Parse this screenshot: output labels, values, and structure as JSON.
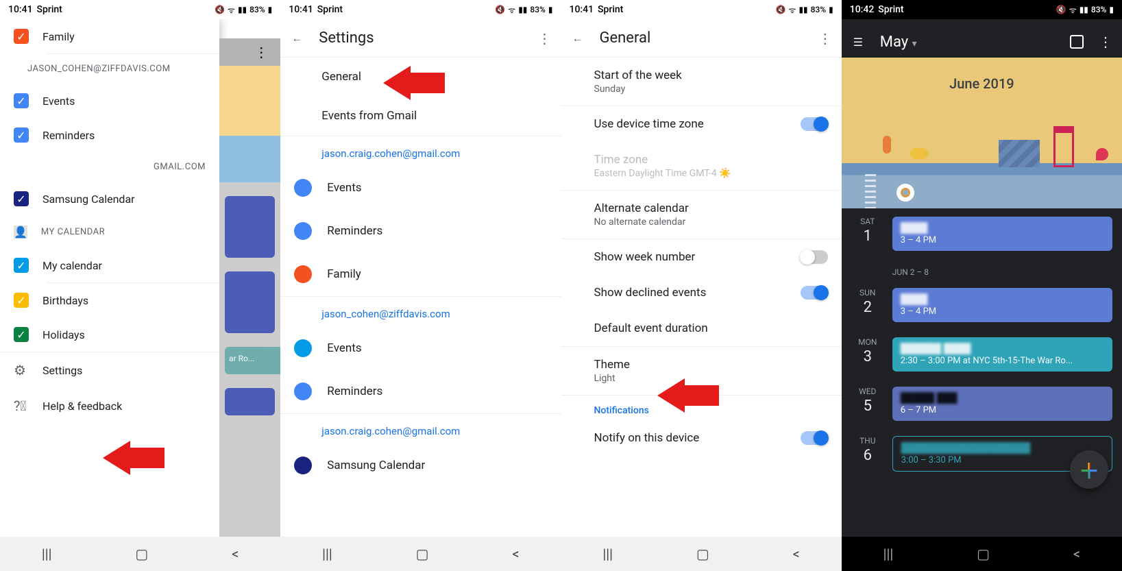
{
  "statusbar": {
    "time1": "10:41",
    "time4": "10:42",
    "carrier": "Sprint",
    "battery": "83%"
  },
  "screen1": {
    "drawer": {
      "family": {
        "label": "Family",
        "color": "#f4511e"
      },
      "acct1_email": "JASON_COHEN@ZIFFDAVIS.COM",
      "acct1": [
        {
          "label": "Events",
          "color": "#4285f4"
        },
        {
          "label": "Reminders",
          "color": "#4285f4"
        }
      ],
      "acct2_label": "GMAIL.COM",
      "acct2": [
        {
          "label": "Samsung Calendar",
          "color": "#1a237e"
        }
      ],
      "mycal_label": "MY CALENDAR",
      "mycal": [
        {
          "label": "My calendar",
          "color": "#039be5"
        },
        {
          "label": "Birthdays",
          "color": "#fbbc04"
        },
        {
          "label": "Holidays",
          "color": "#0b8043"
        }
      ],
      "settings": "Settings",
      "help": "Help & feedback"
    }
  },
  "screen2": {
    "title": "Settings",
    "top": [
      "General",
      "Events from Gmail"
    ],
    "accounts": [
      {
        "email": "jason.craig.cohen@gmail.com",
        "items": [
          {
            "label": "Events",
            "color": "#4285f4"
          },
          {
            "label": "Reminders",
            "color": "#4285f4"
          },
          {
            "label": "Family",
            "color": "#f4511e"
          }
        ]
      },
      {
        "email": "jason_cohen@ziffdavis.com",
        "items": [
          {
            "label": "Events",
            "color": "#039be5"
          },
          {
            "label": "Reminders",
            "color": "#4285f4"
          }
        ]
      },
      {
        "email": "jason.craig.cohen@gmail.com",
        "items": [
          {
            "label": "Samsung Calendar",
            "color": "#1a237e"
          }
        ]
      }
    ]
  },
  "screen3": {
    "title": "General",
    "rows": {
      "start_week": {
        "t": "Start of the week",
        "s": "Sunday"
      },
      "device_tz": {
        "t": "Use device time zone",
        "on": true
      },
      "tz": {
        "t": "Time zone",
        "s": "Eastern Daylight Time  GMT-4 ☀️"
      },
      "alt": {
        "t": "Alternate calendar",
        "s": "No alternate calendar"
      },
      "weeknum": {
        "t": "Show week number",
        "on": false
      },
      "declined": {
        "t": "Show declined events",
        "on": true
      },
      "duration": {
        "t": "Default event duration"
      },
      "theme": {
        "t": "Theme",
        "s": "Light"
      },
      "notify_section": "Notifications",
      "notify": {
        "t": "Notify on this device",
        "on": true
      }
    }
  },
  "screen4": {
    "month_btn": "May",
    "month_header": "June 2019",
    "week_label": "JUN 2 – 8",
    "days": [
      {
        "dow": "SAT",
        "num": "1",
        "evt": {
          "time": "3 – 4 PM",
          "cls": "blue"
        }
      },
      {
        "dow": "SUN",
        "num": "2",
        "evt": {
          "time": "3 – 4 PM",
          "cls": "blue"
        }
      },
      {
        "dow": "MON",
        "num": "3",
        "evt": {
          "time": "2:30 – 3:00 PM at NYC 5th-15-The War Ro...",
          "cls": "teal"
        }
      },
      {
        "dow": "WED",
        "num": "5",
        "evt": {
          "time": "6 – 7 PM",
          "cls": "purple"
        }
      },
      {
        "dow": "THU",
        "num": "6",
        "evt": {
          "time": "3:00 – 3:30 PM",
          "cls": "outline"
        }
      }
    ]
  }
}
